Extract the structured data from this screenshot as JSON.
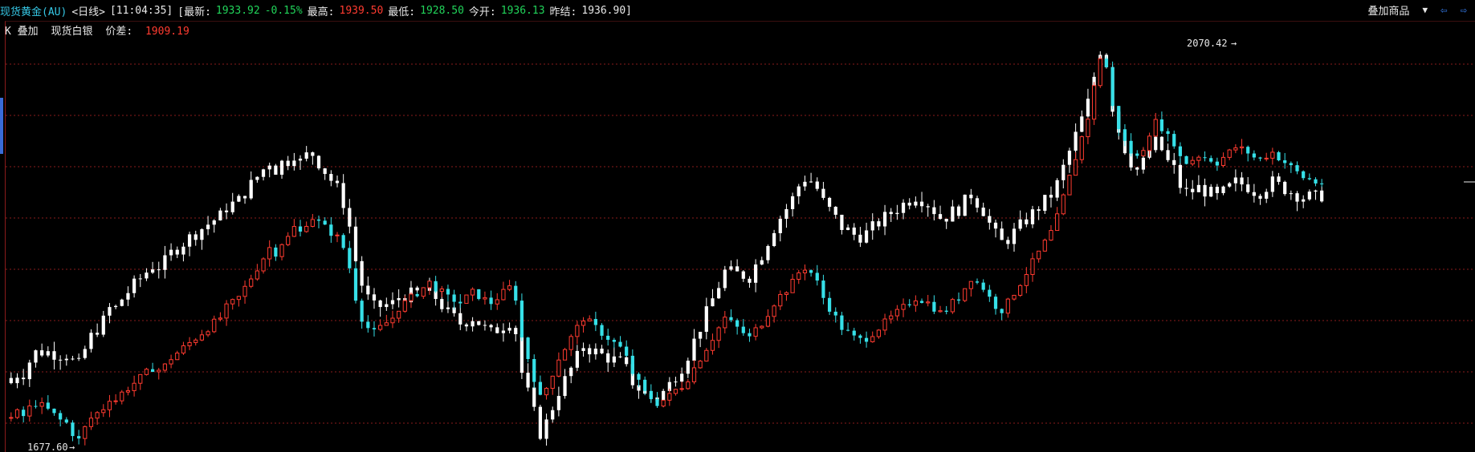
{
  "header": {
    "symbol": "现货黄金(AU)",
    "period": "<日线>",
    "time": "[11:04:35]",
    "latest_label": "[最新:",
    "latest_value": "1933.92",
    "change_pct": "-0.15%",
    "high_label": "最高:",
    "high_value": "1939.50",
    "low_label": "最低:",
    "low_value": "1928.50",
    "open_label": "今开:",
    "open_value": "1936.13",
    "prev_close_label": "昨结:",
    "prev_close_value": "1936.90]"
  },
  "toolbar": {
    "overlay_button": "叠加商品",
    "dropdown_icon": "triangle-down",
    "nav_left_icon": "arrow-left",
    "nav_right_icon": "arrow-right"
  },
  "overlay": {
    "prefix": "K 叠加",
    "instrument": "现货白银",
    "spread_label": "价差:",
    "spread_value": "1909.19"
  },
  "colors": {
    "background": "#000000",
    "grid": "#8a1b1b",
    "up": "#ff3b30",
    "down": "#36e0e8",
    "overlay": "#ffffff",
    "accent": "#36c8e6"
  },
  "chart_data": {
    "type": "candlestick",
    "main_series": {
      "name": "现货黄金(AU)",
      "price_range": [
        1677.6,
        2070.42
      ],
      "max_label": "2070.42",
      "min_label": "1677.60",
      "closes": [
        1700,
        1705,
        1702,
        1710,
        1715,
        1712,
        1708,
        1703,
        1698,
        1695,
        1685,
        1678,
        1690,
        1700,
        1705,
        1710,
        1720,
        1718,
        1725,
        1730,
        1735,
        1740,
        1745,
        1750,
        1748,
        1752,
        1760,
        1765,
        1770,
        1775,
        1780,
        1785,
        1790,
        1795,
        1800,
        1810,
        1815,
        1820,
        1830,
        1840,
        1850,
        1860,
        1870,
        1865,
        1875,
        1880,
        1890,
        1885,
        1895,
        1900,
        1895,
        1890,
        1885,
        1880,
        1870,
        1850,
        1820,
        1800,
        1790,
        1785,
        1790,
        1795,
        1800,
        1810,
        1815,
        1820,
        1825,
        1830,
        1835,
        1830,
        1825,
        1820,
        1818,
        1815,
        1820,
        1825,
        1822,
        1818,
        1815,
        1820,
        1825,
        1830,
        1820,
        1780,
        1760,
        1740,
        1720,
        1730,
        1745,
        1760,
        1770,
        1780,
        1790,
        1800,
        1795,
        1790,
        1785,
        1780,
        1775,
        1770,
        1760,
        1745,
        1735,
        1725,
        1720,
        1715,
        1718,
        1722,
        1728,
        1732,
        1740,
        1750,
        1760,
        1770,
        1780,
        1790,
        1800,
        1795,
        1790,
        1785,
        1780,
        1788,
        1795,
        1805,
        1815,
        1822,
        1828,
        1835,
        1845,
        1850,
        1845,
        1835,
        1820,
        1810,
        1800,
        1790,
        1785,
        1780,
        1778,
        1780,
        1785,
        1790,
        1795,
        1800,
        1805,
        1810,
        1815,
        1820,
        1818,
        1815,
        1810,
        1805,
        1808,
        1815,
        1820,
        1830,
        1840,
        1835,
        1830,
        1820,
        1812,
        1808,
        1815,
        1825,
        1835,
        1845,
        1855,
        1865,
        1875,
        1885,
        1900,
        1920,
        1940,
        1960,
        1980,
        2000,
        2030,
        2060,
        2050,
        2010,
        1990,
        1975,
        1965,
        1960,
        1970,
        1985,
        1995,
        1990,
        1980,
        1975,
        1960,
        1955,
        1958,
        1962,
        1960,
        1958,
        1955,
        1960,
        1965,
        1970,
        1968,
        1965,
        1960,
        1958,
        1962,
        1965,
        1960,
        1955,
        1950,
        1945,
        1940,
        1938,
        1935,
        1934
      ]
    },
    "overlay_series": {
      "name": "现货白银",
      "spread": "1909.19"
    }
  }
}
